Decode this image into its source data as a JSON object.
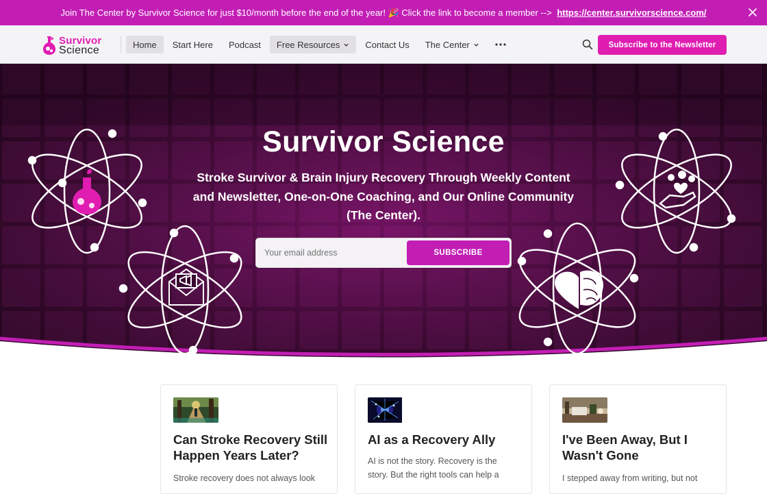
{
  "announcement": {
    "message": "Join The Center by Survivor Science for just $10/month before the end of the year! 🎉 Click the link to become a member -->",
    "link_text": "https://center.survivorscience.com/"
  },
  "logo": {
    "line1": "Survivor",
    "line2": "Science"
  },
  "nav": {
    "home": "Home",
    "start_here": "Start Here",
    "podcast": "Podcast",
    "free_resources": "Free Resources",
    "contact_us": "Contact Us",
    "the_center": "The Center"
  },
  "header": {
    "subscribe_label": "Subscribe to the Newsletter"
  },
  "hero": {
    "title": "Survivor Science",
    "subtitle": "Stroke Survivor & Brain Injury Recovery Through Weekly Content and Newsletter, One-on-One Coaching, and Our Online Community (The Center).",
    "email_placeholder": "Your email address",
    "subscribe_label": "SUBSCRIBE"
  },
  "cards": [
    {
      "title": "Can Stroke Recovery Still Happen Years Later?",
      "excerpt": "Stroke recovery does not always look"
    },
    {
      "title": "AI as a Recovery Ally",
      "excerpt": "AI is not the story. Recovery is the story. But the right tools can help a"
    },
    {
      "title": "I've Been Away, But I Wasn't Gone",
      "excerpt": "I stepped away from writing, but not"
    }
  ],
  "colors": {
    "brand": "#e01db1",
    "banner": "#c21eb4",
    "hero_dark": "#3a0a30"
  }
}
